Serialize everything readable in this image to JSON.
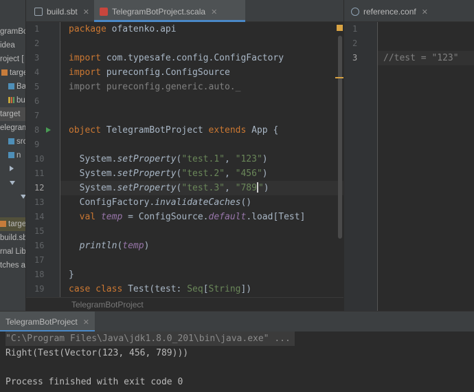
{
  "project_tree": {
    "rows": [
      {
        "label": "gramBo",
        "icon": "none"
      },
      {
        "label": "idea",
        "icon": "none"
      },
      {
        "label": "roject [",
        "icon": "none"
      },
      {
        "label": "targe",
        "icon": "folder-orange"
      },
      {
        "label": "Base",
        "icon": "folder-blue"
      },
      {
        "label": "buil",
        "icon": "sbt-bars"
      },
      {
        "label": "target",
        "icon": "none"
      },
      {
        "label": "elegram",
        "icon": "none"
      },
      {
        "label": "src",
        "icon": "folder-blue"
      },
      {
        "label": "n",
        "icon": "folder-blue"
      },
      {
        "label": "",
        "icon": "arrow-right"
      },
      {
        "label": "",
        "icon": "arrow-down"
      },
      {
        "label": "",
        "icon": "arrow-down"
      },
      {
        "label": "",
        "icon": "none"
      },
      {
        "label": "targe",
        "icon": "folder-orange"
      },
      {
        "label": "build.sb",
        "icon": "none"
      },
      {
        "label": "rnal Lib",
        "icon": "none"
      },
      {
        "label": "tches a",
        "icon": "none"
      }
    ]
  },
  "tabs": {
    "left": [
      {
        "label": "build.sbt",
        "icon": "sbt-file-icon",
        "active": false
      },
      {
        "label": "TelegramBotProject.scala",
        "icon": "scala-file-icon",
        "active": true
      }
    ],
    "right": [
      {
        "label": "reference.conf",
        "icon": "conf-file-icon",
        "active": false
      }
    ]
  },
  "editor_main": {
    "current_line": 12,
    "lines": [
      {
        "n": "1",
        "html": "<span class='kw'>package</span> ofatenko.api"
      },
      {
        "n": "2",
        "html": ""
      },
      {
        "n": "3",
        "html": "<span class='kw'>import</span> com.typesafe.config.ConfigFactory"
      },
      {
        "n": "4",
        "html": "<span class='kw'>import</span> pureconfig.ConfigSource"
      },
      {
        "n": "5",
        "html": "<span class='gray'>import pureconfig.generic.auto._</span>"
      },
      {
        "n": "6",
        "html": ""
      },
      {
        "n": "7",
        "html": ""
      },
      {
        "n": "8",
        "html": "<span class='kw'>object</span> TelegramBotProject <span class='kw'>extends</span> App {"
      },
      {
        "n": "9",
        "html": ""
      },
      {
        "n": "10",
        "html": "  System.<span class='it'>setProperty</span>(<span class='str'>\"test.1\"</span>, <span class='str'>\"123\"</span>)"
      },
      {
        "n": "11",
        "html": "  System.<span class='it'>setProperty</span>(<span class='str'>\"test.2\"</span>, <span class='str'>\"456\"</span>)"
      },
      {
        "n": "12",
        "html": "  System.<span class='it'>setProperty</span>(<span class='str'>\"test.3\"</span>, <span class='str'>\"789<span class='caret'></span>\"</span>)"
      },
      {
        "n": "13",
        "html": "  ConfigFactory.<span class='it'>invalidateCaches</span>()"
      },
      {
        "n": "14",
        "html": "  <span class='kw'>val</span> <span class='pur'>temp</span> = ConfigSource.<span class='pur'>default</span>.load[Test]"
      },
      {
        "n": "15",
        "html": ""
      },
      {
        "n": "16",
        "html": "  <span class='it'>println</span>(<span class='pur'>temp</span>)"
      },
      {
        "n": "17",
        "html": ""
      },
      {
        "n": "18",
        "html": "}"
      },
      {
        "n": "19",
        "html": "<span class='kw'>case class</span> Test(test: <span class='str'>Seq</span>[<span class='str'>String</span>])"
      }
    ]
  },
  "editor_right": {
    "current_line": 3,
    "lines": [
      {
        "n": "1",
        "html": ""
      },
      {
        "n": "2",
        "html": ""
      },
      {
        "n": "3",
        "html": "<span class='gray'>//test = \"123\"</span>"
      }
    ]
  },
  "breadcrumb": "TelegramBotProject",
  "run_panel": {
    "tab_label": "TelegramBotProject",
    "lines": [
      "\"C:\\Program Files\\Java\\jdk1.8.0_201\\bin\\java.exe\" ...",
      "Right(Test(Vector(123, 456, 789)))",
      "",
      "Process finished with exit code 0"
    ]
  },
  "colors": {
    "keyword": "#cc7832",
    "string": "#6a8759",
    "field": "#9876aa",
    "comment": "#808080",
    "text": "#a9b7c6",
    "accent": "#4a88c7"
  }
}
